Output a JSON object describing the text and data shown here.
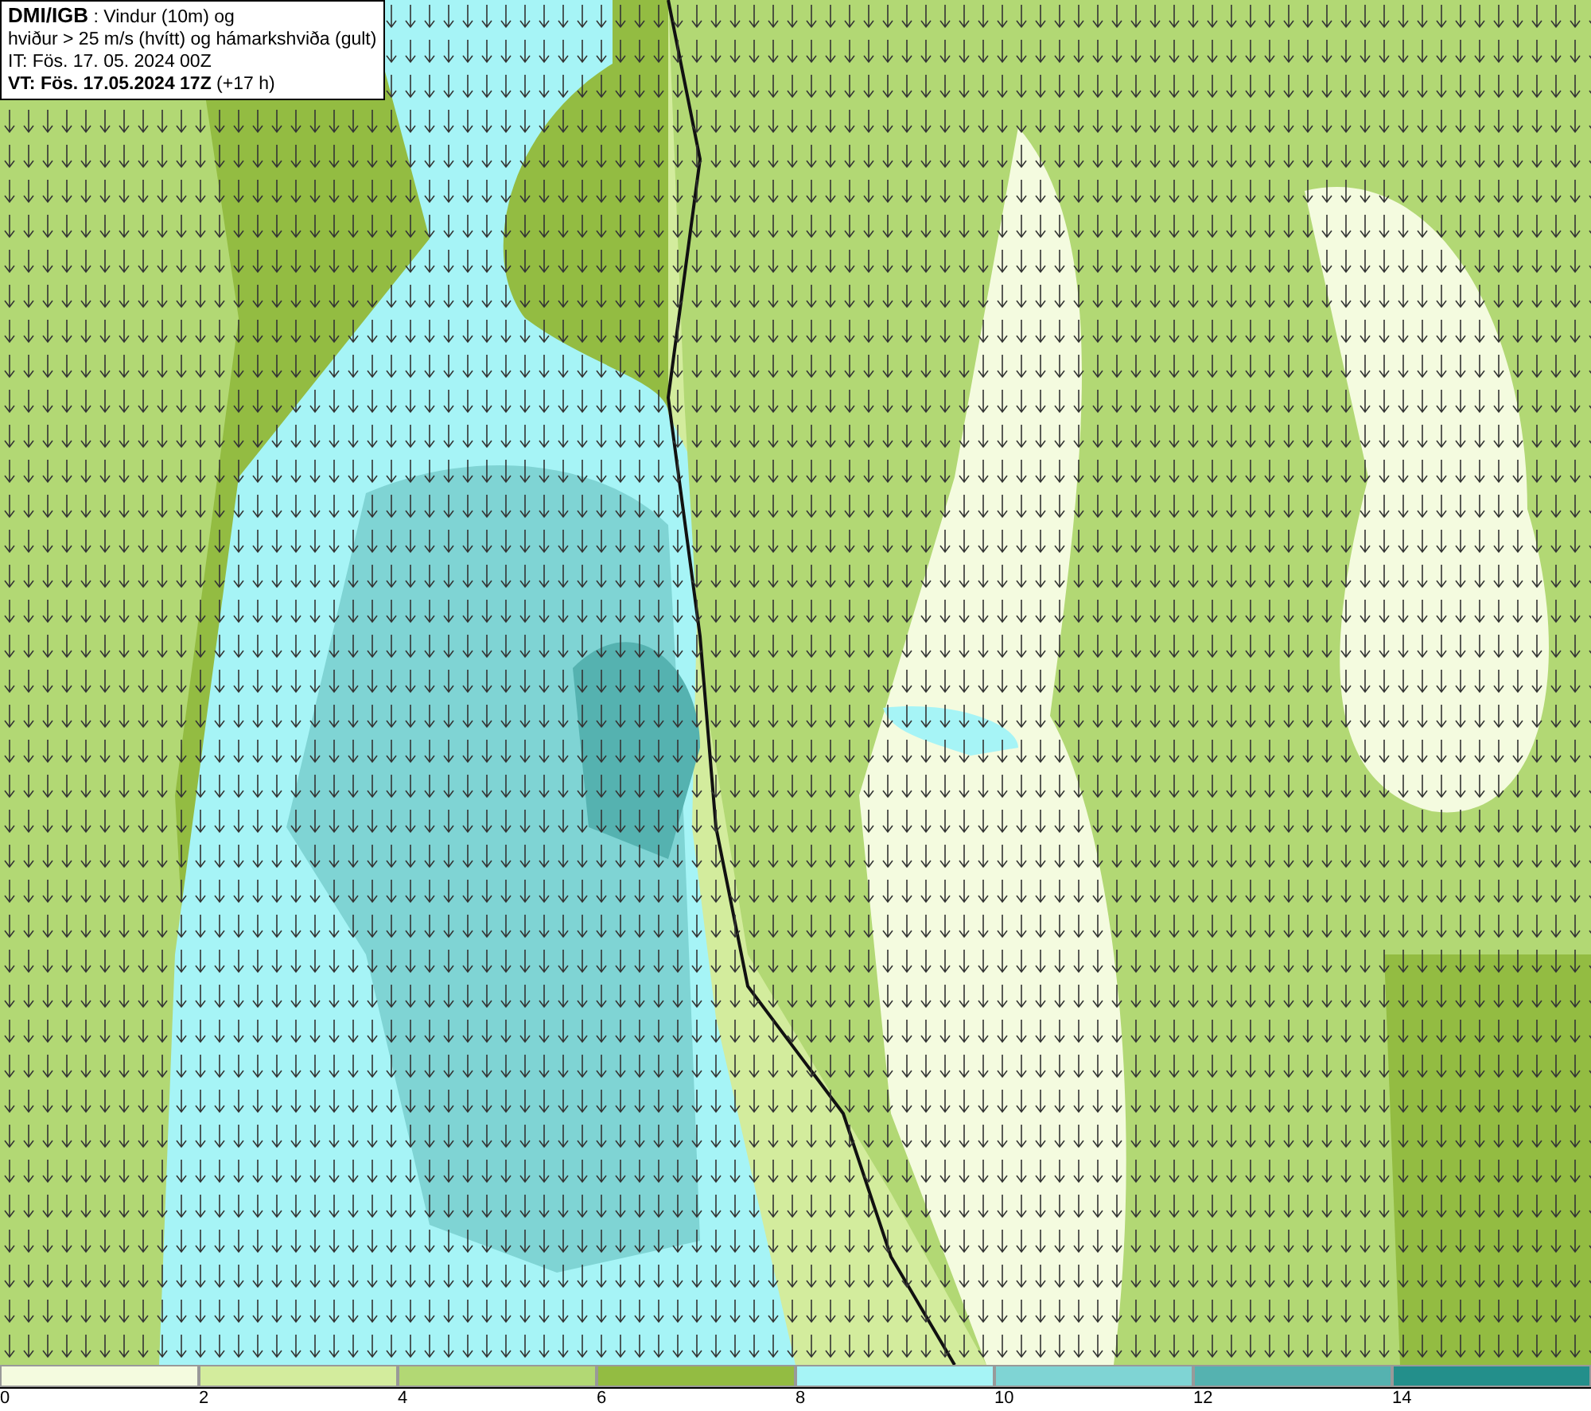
{
  "header": {
    "lines": [
      "**DMI/IGB** : Vindur (10m) og",
      "hviður > 25 m/s (hvítt) og hámarkshviða (gult)",
      "IT: Fös. 17. 05. 2024 00Z",
      "**VT: Fös. 17.05.2024 17Z** (+17 h)"
    ]
  },
  "legend": [
    {
      "label": "0",
      "color": "#f4fbdf"
    },
    {
      "label": "2",
      "color": "#d3ec9d"
    },
    {
      "label": "4",
      "color": "#b2d874"
    },
    {
      "label": "6",
      "color": "#93bc42"
    },
    {
      "label": "8",
      "color": "#a6f4f6"
    },
    {
      "label": "10",
      "color": "#7fd4d4"
    },
    {
      "label": "12",
      "color": "#55b2b0"
    },
    {
      "label": "14",
      "color": "#238f8b"
    }
  ]
}
